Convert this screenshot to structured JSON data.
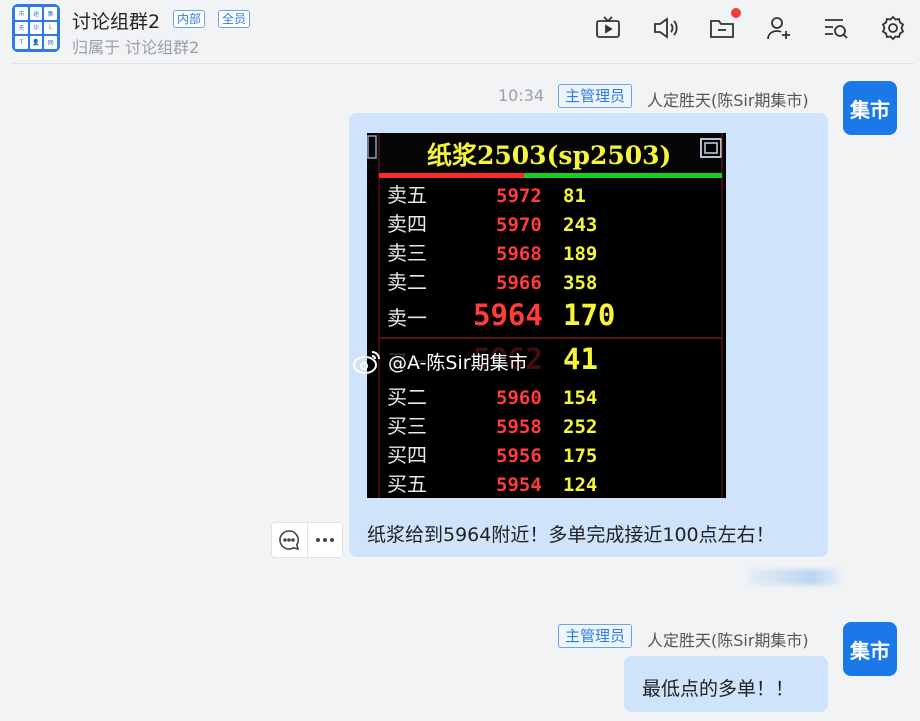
{
  "header": {
    "avatar_chars": [
      "市",
      "途",
      "集",
      "天",
      "华",
      "L",
      "T",
      "👤",
      "网"
    ],
    "title": "讨论组群2",
    "tag_inner": "内部",
    "tag_all": "全员",
    "subtitle": "归属于 讨论组群2",
    "toolbar": [
      {
        "icon": "tv-icon",
        "label": "tv"
      },
      {
        "icon": "speaker-icon",
        "label": "mute"
      },
      {
        "icon": "folder-icon",
        "label": "files"
      },
      {
        "icon": "add-user-icon",
        "label": "add member"
      },
      {
        "icon": "search-list-icon",
        "label": "search messages"
      },
      {
        "icon": "gear-icon",
        "label": "settings"
      }
    ],
    "notification_color": "#f03c3c"
  },
  "messages": [
    {
      "time": "10:34",
      "role": "主管理员",
      "sender": "人定胜天(陈Sir期集市)",
      "avatar_text": "集市",
      "image": {
        "title": "纸浆2503(sp2503)",
        "asks": [
          {
            "label": "卖五",
            "price": "5972",
            "volume": "81"
          },
          {
            "label": "卖四",
            "price": "5970",
            "volume": "243"
          },
          {
            "label": "卖三",
            "price": "5968",
            "volume": "189"
          },
          {
            "label": "卖二",
            "price": "5966",
            "volume": "358"
          },
          {
            "label": "卖一",
            "price": "5964",
            "volume": "170"
          }
        ],
        "bids": [
          {
            "label": "买一",
            "price": "5962",
            "volume": "41"
          },
          {
            "label": "买二",
            "price": "5960",
            "volume": "154"
          },
          {
            "label": "买三",
            "price": "5958",
            "volume": "252"
          },
          {
            "label": "买四",
            "price": "5956",
            "volume": "175"
          },
          {
            "label": "买五",
            "price": "5954",
            "volume": "124"
          }
        ],
        "watermark": "@A-陈Sir期集市"
      },
      "text": "纸浆给到5964附近！多单完成接近100点左右！"
    },
    {
      "role": "主管理员",
      "sender": "人定胜天(陈Sir期集市)",
      "avatar_text": "集市",
      "text": "最低点的多单！！"
    }
  ],
  "colors": {
    "accent": "#1a78e8",
    "bubble": "#cfe4fb",
    "price_red": "#ff3b3b",
    "volume_yellow": "#f5f53a"
  }
}
